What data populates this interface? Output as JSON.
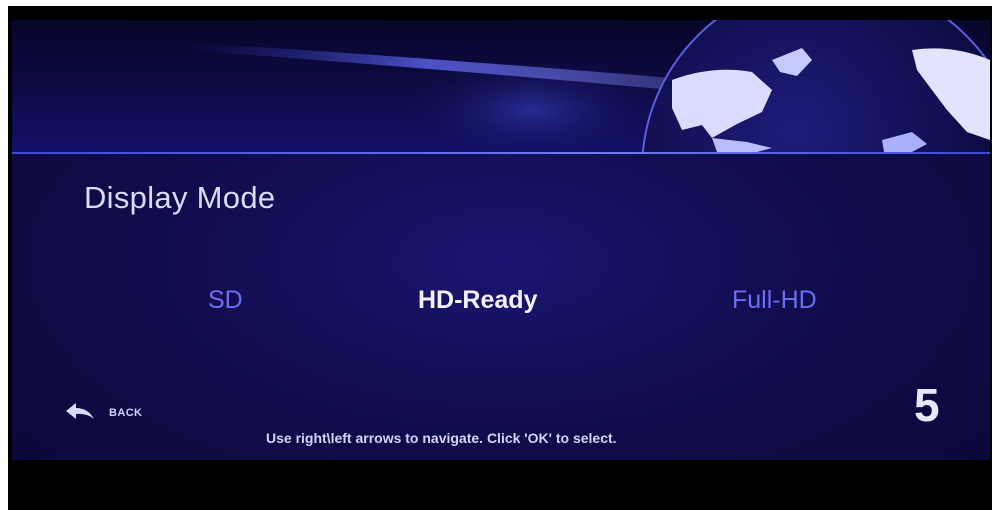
{
  "screen": {
    "title": "Display Mode",
    "options": [
      {
        "label": "SD",
        "selected": false
      },
      {
        "label": "HD-Ready",
        "selected": true
      },
      {
        "label": "Full-HD",
        "selected": false
      }
    ],
    "back_label": "BACK",
    "back_icon": "back-arrow-icon",
    "page_number": "5",
    "hint": "Use right\\left arrows to navigate. Click 'OK' to select."
  },
  "colors": {
    "background": "#110d4e",
    "selected_option": "#f2f2ff",
    "unselected_option": "#6b6ef0",
    "divider": "#6f7cf0"
  }
}
